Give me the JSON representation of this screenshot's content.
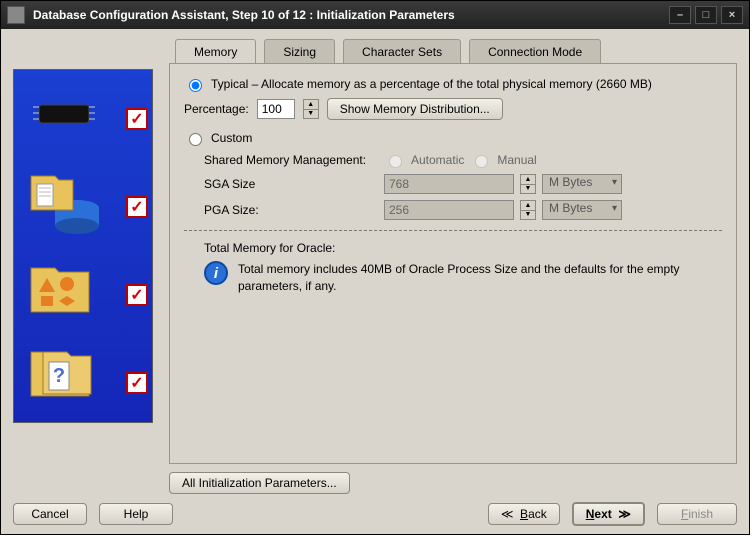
{
  "window": {
    "title": "Database Configuration Assistant, Step 10 of 12 : Initialization Parameters"
  },
  "tabs": {
    "memory": "Memory",
    "sizing": "Sizing",
    "charsets": "Character Sets",
    "connmode": "Connection Mode"
  },
  "memory": {
    "typical_label": "Typical – Allocate memory as a percentage of the total physical memory (2660 MB)",
    "percentage_label": "Percentage:",
    "percentage_value": "100",
    "show_dist": "Show Memory Distribution...",
    "custom_label": "Custom",
    "shared_mgmt_label": "Shared Memory Management:",
    "automatic": "Automatic",
    "manual": "Manual",
    "sga_label": "SGA Size",
    "sga_value": "768",
    "pga_label": "PGA Size:",
    "pga_value": "256",
    "unit": "M Bytes",
    "total_label": "Total Memory for Oracle:",
    "total_text": "Total memory includes 40MB of Oracle Process Size and the defaults for the empty parameters, if any."
  },
  "buttons": {
    "all_params": "All Initialization Parameters...",
    "cancel": "Cancel",
    "help": "Help",
    "back": "Back",
    "next": "Next",
    "finish": "Finish"
  }
}
